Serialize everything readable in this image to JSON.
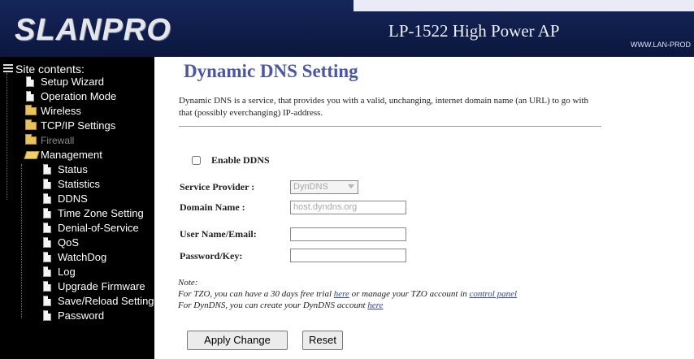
{
  "header": {
    "logo": "LANPRO",
    "product": "LP-1522 High Power AP",
    "site_url": "WWW.LAN-PROD"
  },
  "sidebar": {
    "title": "Site contents:",
    "items": [
      {
        "label": "Setup Wizard",
        "icon": "page-icon"
      },
      {
        "label": "Operation Mode",
        "icon": "page-icon"
      },
      {
        "label": "Wireless",
        "icon": "folder-icon"
      },
      {
        "label": "TCP/IP Settings",
        "icon": "folder-icon"
      },
      {
        "label": "Firewall",
        "icon": "folder-icon",
        "disabled": true
      },
      {
        "label": "Management",
        "icon": "open-folder-icon"
      },
      {
        "label": "Status",
        "icon": "page-icon"
      },
      {
        "label": "Statistics",
        "icon": "page-icon"
      },
      {
        "label": "DDNS",
        "icon": "page-icon"
      },
      {
        "label": "Time Zone Setting",
        "icon": "page-icon"
      },
      {
        "label": "Denial-of-Service",
        "icon": "page-icon"
      },
      {
        "label": "QoS",
        "icon": "page-icon"
      },
      {
        "label": "WatchDog",
        "icon": "page-icon"
      },
      {
        "label": "Log",
        "icon": "page-icon"
      },
      {
        "label": "Upgrade Firmware",
        "icon": "page-icon"
      },
      {
        "label": "Save/Reload Setting",
        "icon": "page-icon"
      },
      {
        "label": "Password",
        "icon": "page-icon"
      }
    ]
  },
  "main": {
    "title": "Dynamic DNS  Setting",
    "intro": "Dynamic DNS is a service, that provides you with a valid, unchanging, internet domain name (an URL) to go with that (possibly everchanging) IP-address.",
    "enable_label": "Enable DDNS",
    "enable_checked": false,
    "fields": {
      "provider_label": "Service Provider :",
      "provider_value": "DynDNS",
      "domain_label": "Domain Name :",
      "domain_value": "host.dyndns.org",
      "user_label": "User Name/Email:",
      "user_value": "",
      "password_label": "Password/Key:",
      "password_value": ""
    },
    "note": {
      "heading": "Note:",
      "tzo_prefix": "For TZO, you can have a 30 days free trial",
      "tzo_link": "here",
      "tzo_middle": "or manage your TZO account in",
      "tzo_link2": "control panel",
      "dyndns_prefix": "For DynDNS, you can create your DynDNS account",
      "dyndns_link": "here"
    },
    "buttons": {
      "apply": "Apply Change",
      "reset": "Reset"
    }
  },
  "colors": {
    "header_bg": "#13245a",
    "sidebar_bg": "#000000",
    "title_color": "#4b57a6",
    "link_color": "#3344aa"
  }
}
